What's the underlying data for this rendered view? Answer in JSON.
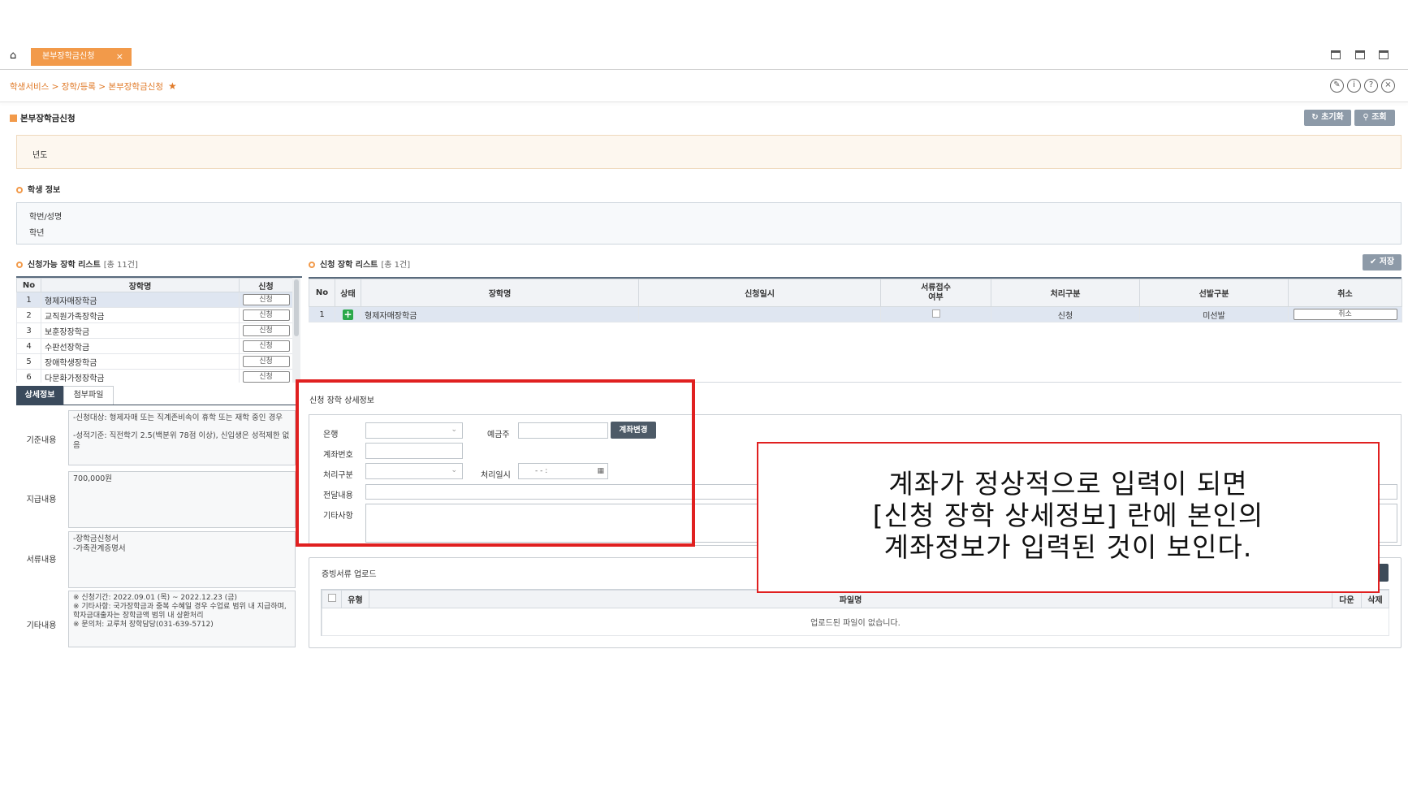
{
  "tabbar": {
    "tab_label": "본부장학금신청",
    "tab_close": "×"
  },
  "breadcrumb": {
    "text": "학생서비스 > 장학/등록 > 본부장학금신청",
    "star": "★"
  },
  "header_icons": [
    "edit-icon",
    "info-icon",
    "help-icon",
    "close-icon"
  ],
  "page": {
    "title": "본부장학금신청",
    "reset_label": "초기화",
    "search_label": "조회",
    "year_label": "년도"
  },
  "student": {
    "section_title": "학생 정보",
    "id_name_label": "학번/성명",
    "grade_label": "학년"
  },
  "available_list": {
    "title": "신청가능 장학 리스트",
    "count": "[총 11건]",
    "headers": [
      "No",
      "장학명",
      "신청"
    ],
    "rows": [
      {
        "no": "1",
        "name": "형제자매장학금",
        "btn": "신청"
      },
      {
        "no": "2",
        "name": "교직원가족장학금",
        "btn": "신청"
      },
      {
        "no": "3",
        "name": "보훈장장학금",
        "btn": "신청"
      },
      {
        "no": "4",
        "name": "수판선장학금",
        "btn": "신청"
      },
      {
        "no": "5",
        "name": "장애학생장학금",
        "btn": "신청"
      },
      {
        "no": "6",
        "name": "다문화가정장학금",
        "btn": "신청"
      }
    ]
  },
  "applied_list": {
    "title": "신청 장학 리스트",
    "count": "[총 1건]",
    "save_label": "저장",
    "headers": [
      "No",
      "상태",
      "장학명",
      "신청일시",
      "서류접수\n여부",
      "처리구분",
      "선발구분",
      "취소"
    ],
    "rows": [
      {
        "no": "1",
        "status_icon": "plus-icon",
        "name": "형제자매장학금",
        "date": "",
        "doc": "",
        "process": "신청",
        "select": "미선발",
        "cancel": "취소"
      }
    ]
  },
  "detail_tabs": {
    "detail": "상세정보",
    "attach": "첨부파일"
  },
  "info": {
    "basic_label": "기준내용",
    "basic_line1": "-신청대상: 형제자매 또는 직계존비속이 휴학 또는 재학 중인 경우",
    "basic_line2": "-성적기준: 직전학기 2.5(백분위 78점 이상), 신입생은 성적제한 없음",
    "pay_label": "지급내용",
    "pay_text": "700,000원",
    "docs_label": "서류내용",
    "docs_line1": "-장학금신청서",
    "docs_line2": "-가족관계증명서",
    "etc_label": "기타내용",
    "etc_line1": "※ 신청기간: 2022.09.01 (목) ~ 2022.12.23 (금)",
    "etc_line2": "※ 기타사항: 국가장학금과 중복 수혜일 경우 수업료 범위 내 지급하며, 학자금대출자는 장학금액 범위 내 상환처리",
    "etc_line3": "※ 문의처: 교루처 장학담당(031-639-5712)"
  },
  "detail_form": {
    "title": "신청 장학 상세정보",
    "bank_label": "은행",
    "holder_label": "예금주",
    "account_change_label": "계좌변경",
    "account_no_label": "계좌번호",
    "process_label": "처리구분",
    "process_date_label": "처리일시",
    "process_date_value": "-  -          :",
    "message_label": "전달내용",
    "etc_label": "기타사항"
  },
  "upload": {
    "title": "증빙서류 업로드",
    "headers": [
      "",
      "유형",
      "파일명",
      "다운",
      "삭제"
    ],
    "empty_text": "업로드된 파일이 없습니다."
  },
  "annotation": {
    "callout_line1": "계좌가 정상적으로 입력이 되면",
    "callout_line2": "[신청 장학 상세정보] 란에 본인의",
    "callout_line3": "계좌정보가 입력된 것이 보인다.",
    "highlight_color": "#e02020"
  },
  "colors": {
    "accent": "#f29a4a",
    "header_dark": "#3a4a5c",
    "success": "#2aa84a"
  }
}
